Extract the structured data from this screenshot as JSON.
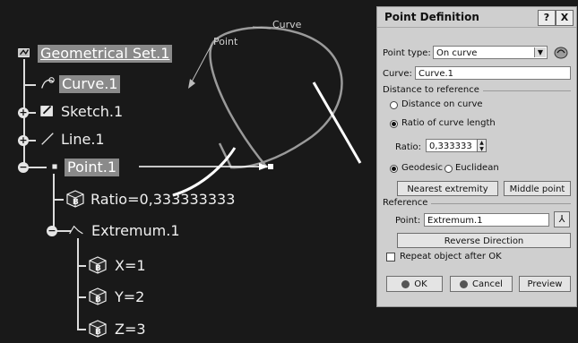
{
  "viewer": {
    "curve_label": "Curve",
    "point_label": "Point"
  },
  "tree": {
    "root": "Geometrical Set.1",
    "curve": "Curve.1",
    "sketch": "Sketch.1",
    "line": "Line.1",
    "point": "Point.1",
    "ratio_param": "Ratio=0,333333333",
    "extremum": "Extremum.1",
    "x_param": "X=1",
    "y_param": "Y=2",
    "z_param": "Z=3"
  },
  "dialog": {
    "title": "Point Definition",
    "help_button": "?",
    "close_button": "X",
    "point_type_label": "Point type:",
    "point_type_value": "On curve",
    "curve_label": "Curve:",
    "curve_value": "Curve.1",
    "distance_section": "Distance to reference",
    "distance_on_curve": "Distance on curve",
    "ratio_of_curve_length": "Ratio of curve length",
    "ratio_label": "Ratio:",
    "ratio_value": "0,333333",
    "geodesic": "Geodesic",
    "euclidean": "Euclidean",
    "nearest_extremity": "Nearest extremity",
    "middle_point": "Middle point",
    "reference_section": "Reference",
    "ref_point_label": "Point:",
    "ref_point_value": "Extremum.1",
    "reverse_direction": "Reverse Direction",
    "repeat_object": "Repeat object after OK",
    "ok": "OK",
    "cancel": "Cancel",
    "preview": "Preview"
  }
}
